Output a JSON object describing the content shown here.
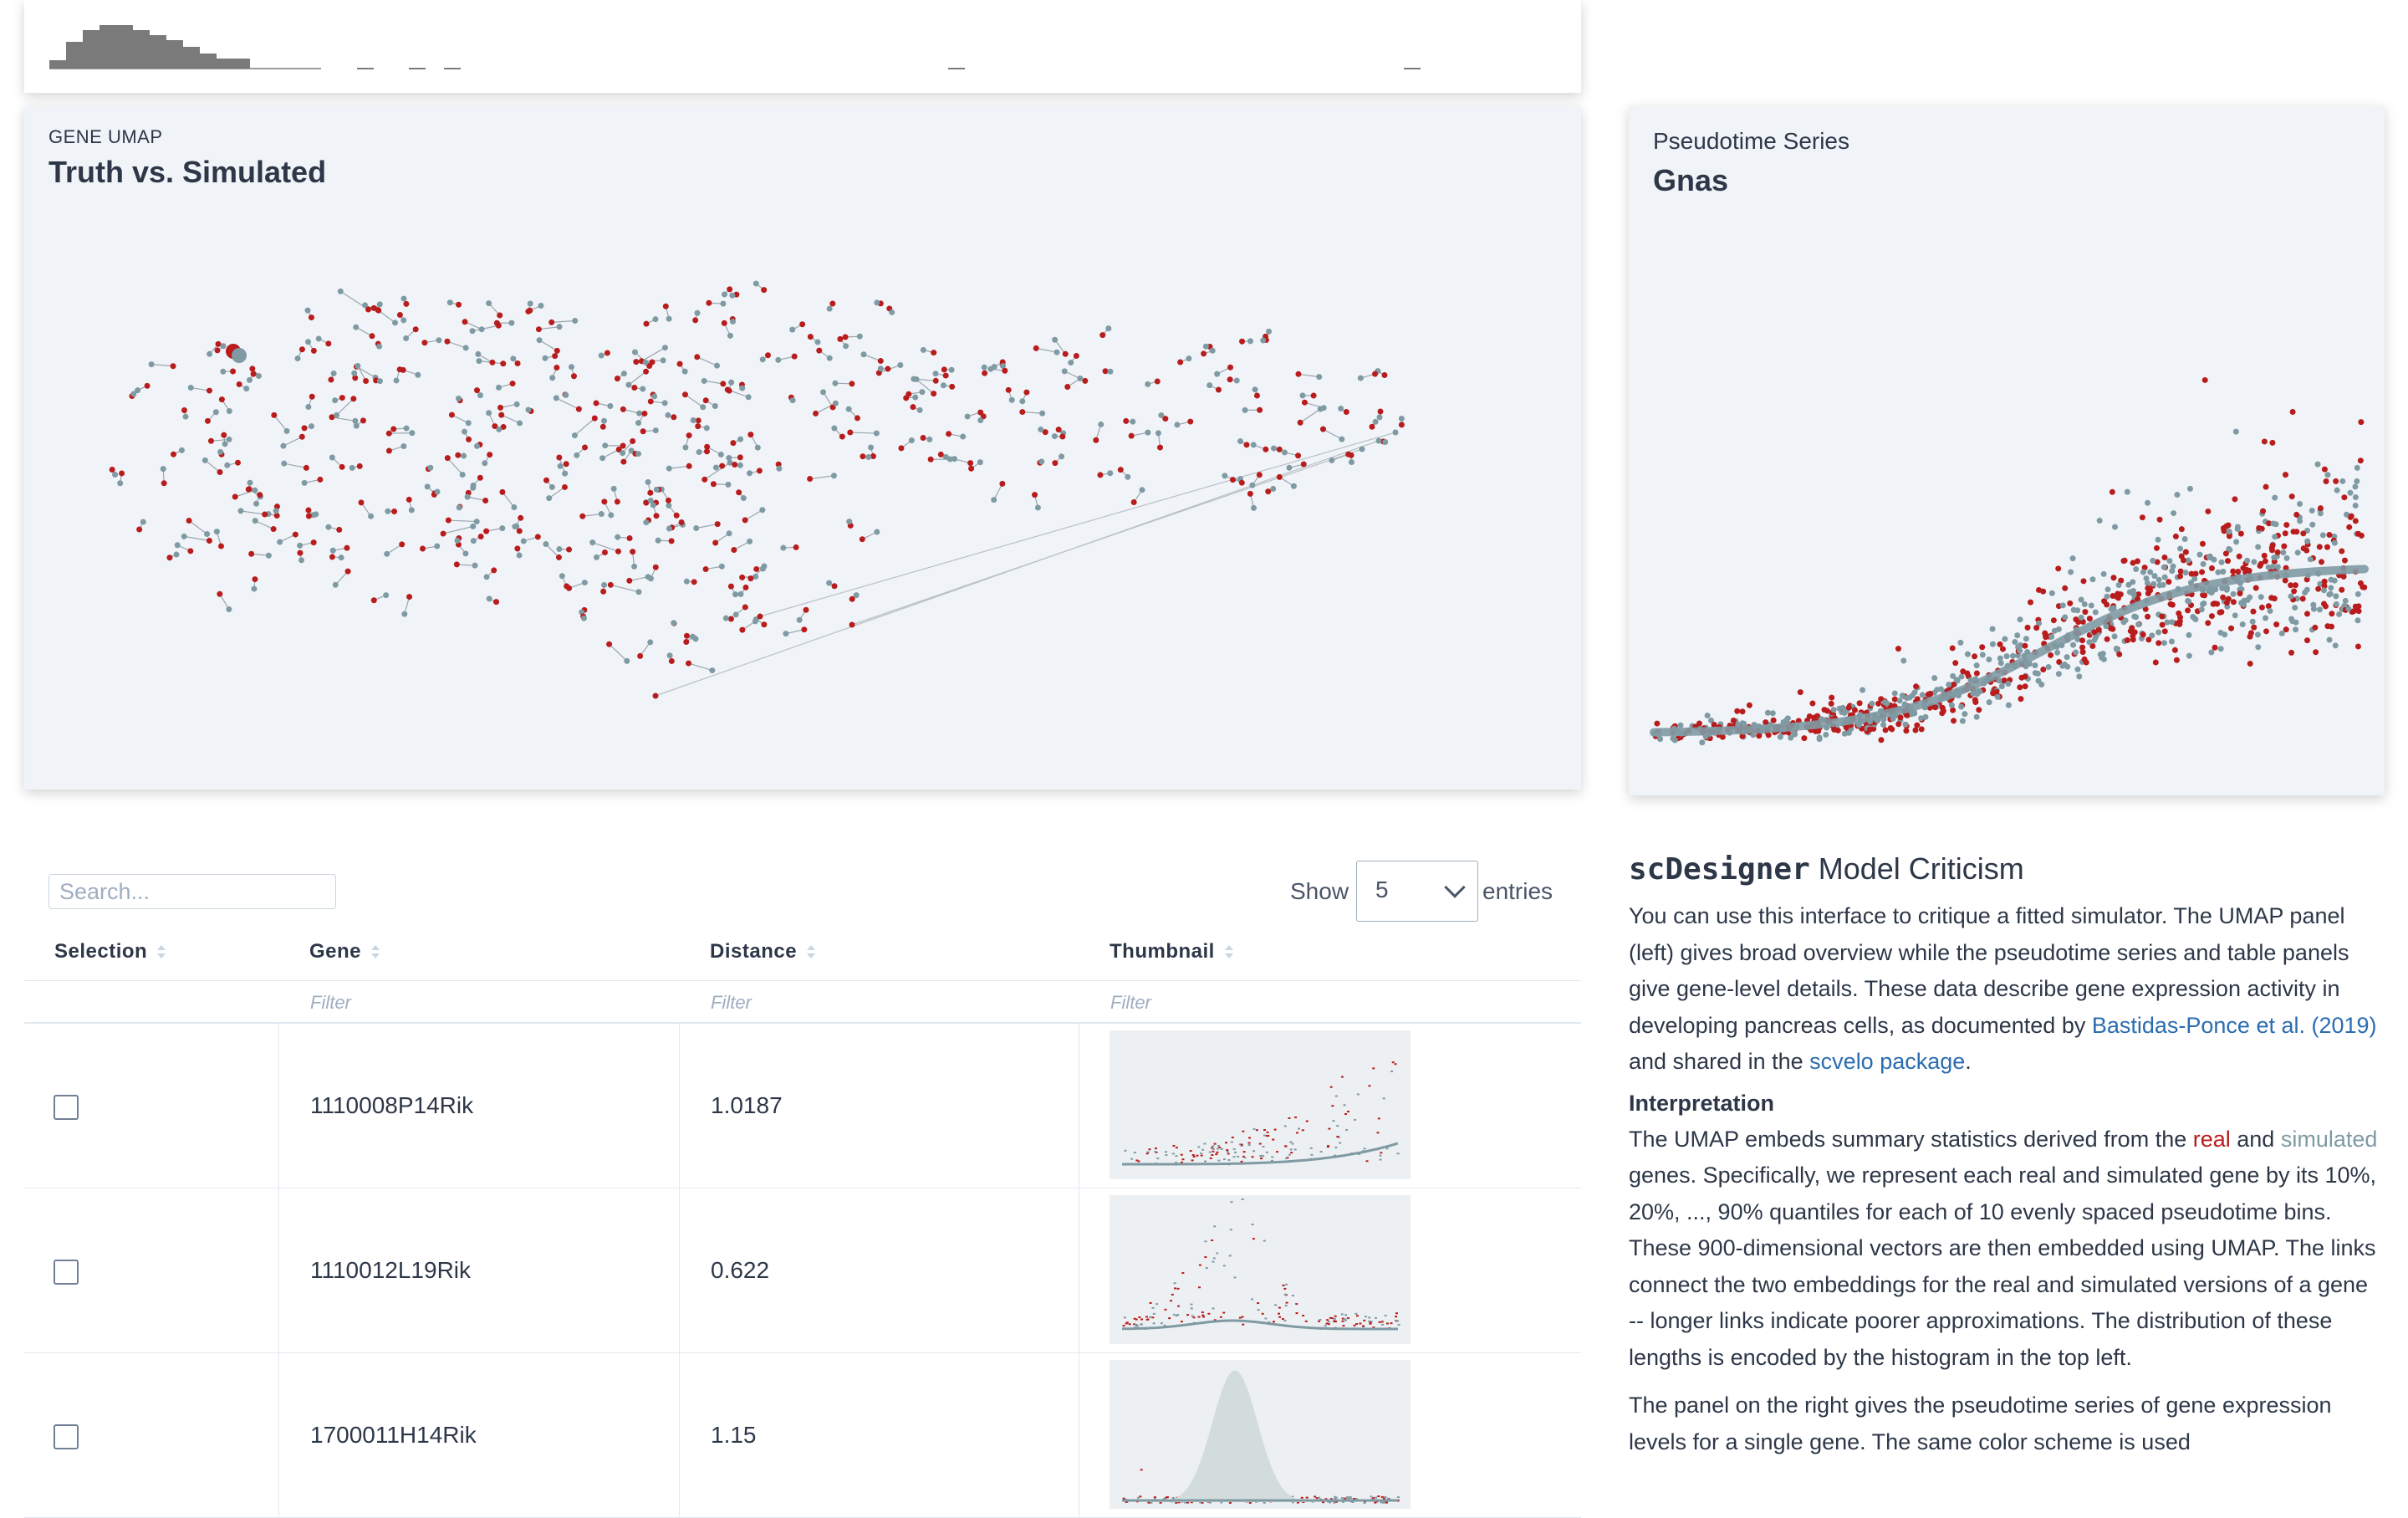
{
  "umap": {
    "eyebrow": "GENE UMAP",
    "title": "Truth vs. Simulated"
  },
  "pseudotime": {
    "eyebrow": "Pseudotime Series",
    "gene": "Gnas"
  },
  "table": {
    "search_placeholder": "Search...",
    "show_label": "Show",
    "entries_value": "5",
    "entries_label": "entries",
    "columns": [
      "Selection",
      "Gene",
      "Distance",
      "Thumbnail"
    ],
    "filter_placeholder": "Filter",
    "rows": [
      {
        "gene": "1110008P14Rik",
        "distance": "1.0187"
      },
      {
        "gene": "1110012L19Rik",
        "distance": "0.622"
      },
      {
        "gene": "1700011H14Rik",
        "distance": "1.15"
      }
    ]
  },
  "about": {
    "title_mono": "scDesigner",
    "title_rest": " Model Criticism",
    "p1_a": "You can use this interface to critique a fitted simulator. The UMAP panel (left) gives broad overview while the pseudotime series and table panels give gene-level details. These data describe gene expression activity in developing pancreas cells, as documented by ",
    "link1": "Bastidas-Ponce et al. (2019)",
    "p1_b": " and shared in the ",
    "link2": "scvelo package",
    "p1_c": ".",
    "interp_heading": "Interpretation",
    "p2_a": "The UMAP embeds summary statistics derived from the ",
    "p2_real": "real",
    "p2_b": " and ",
    "p2_sim": "simulated",
    "p2_c": " genes. Specifically, we represent each real and simulated gene by its 10%, 20%, ..., 90% quantiles for each of 10 evenly spaced pseudotime bins. These 900-dimensional vectors are then embedded using UMAP. The links connect the two embeddings for the real and simulated versions of a gene -- longer links indicate poorer approximations. The distribution of these lengths is encoded by the histogram in the top left.",
    "p3": "The panel on the right gives the pseudotime series of gene expression levels for a single gene. The same color scheme is used"
  },
  "colors": {
    "real": "#b91c1c",
    "simulated": "#7f9aa3",
    "panel_bg": "#f0f4f8",
    "link": "#2b6cb0"
  }
}
